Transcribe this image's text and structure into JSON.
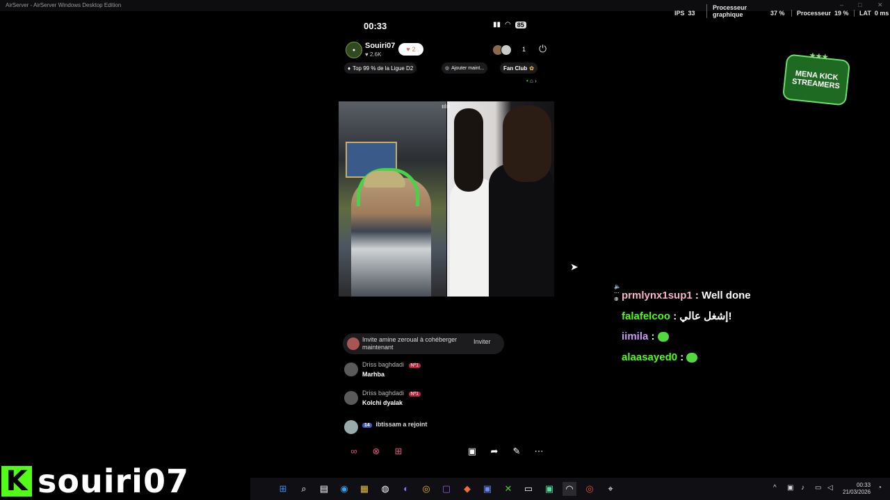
{
  "window": {
    "title": "AirServer - AirServer Windows Desktop Edition"
  },
  "stats": {
    "ips_label": "IPS",
    "ips_value": "33",
    "gpu_label": "Processeur graphique",
    "gpu_value": "37 %",
    "cpu_label": "Processeur",
    "cpu_value": "19 %",
    "lat_label": "LAT",
    "lat_value": "0 ms"
  },
  "phone": {
    "time": "00:33",
    "battery": "85",
    "host": {
      "name": "Souiri07",
      "likes": "♥ 2.6K",
      "heart_count": "2"
    },
    "viewer_count": "1",
    "chips": {
      "rank": "Top 99 % de la Ligue D2",
      "add": "Ajouter maint...",
      "fanclub": "Fan Club"
    },
    "invite": {
      "text": "Invite amine zeroual à cohéberger maintenant",
      "button": "Inviter"
    },
    "messages": [
      {
        "name": "Driss baghdadi",
        "badge": "Nº1",
        "body": "Marhba"
      },
      {
        "name": "Driss baghdadi",
        "badge": "Nº1",
        "body": "Kolchi dyalak"
      }
    ],
    "joined": {
      "level": "14",
      "name": "ibtissam",
      "text": "a rejoint"
    }
  },
  "logo": {
    "line1": "MENA KICK",
    "line2": "STREAMERS"
  },
  "chat": [
    {
      "user": "prmlynx1sup1",
      "message": "Well done",
      "color": "#f4b6c8"
    },
    {
      "user": "falafelcoo",
      "message": "إشغل عالي!",
      "color": "#53fc18"
    },
    {
      "user": "iimila",
      "message": "",
      "color": "#c89cf4"
    },
    {
      "user": "alaasayed0",
      "message": "",
      "color": "#53fc18"
    }
  ],
  "banner": {
    "k": "K",
    "name": "souiri07"
  },
  "clock": {
    "time": "00:33",
    "date": "21/03/2026"
  }
}
